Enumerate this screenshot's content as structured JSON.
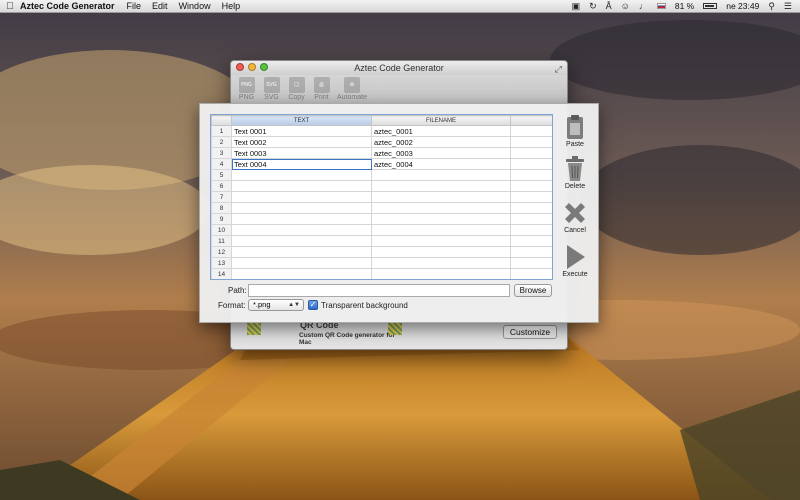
{
  "menubar": {
    "app_name": "Aztec Code Generator",
    "menus": [
      "File",
      "Edit",
      "Window",
      "Help"
    ],
    "status": {
      "battery": "81 %",
      "clock": "ne 23:49"
    }
  },
  "window": {
    "title": "Aztec Code Generator",
    "toolbar": [
      {
        "label": "PNG",
        "icon": "png-icon"
      },
      {
        "label": "SVG",
        "icon": "svg-icon"
      },
      {
        "label": "Copy",
        "icon": "copy-icon"
      },
      {
        "label": "Print",
        "icon": "print-icon"
      },
      {
        "label": "Automate",
        "icon": "automate-icon"
      }
    ],
    "banner": {
      "title": "QR Code",
      "subtitle": "Custom QR Code generator for Mac"
    },
    "customize_label": "Customize"
  },
  "sheet": {
    "columns": [
      "TEXT",
      "FILENAME"
    ],
    "rows": [
      {
        "num": "1",
        "text": "Text 0001",
        "filename": "aztec_0001"
      },
      {
        "num": "2",
        "text": "Text 0002",
        "filename": "aztec_0002"
      },
      {
        "num": "3",
        "text": "Text 0003",
        "filename": "aztec_0003"
      },
      {
        "num": "4",
        "text": "Text 0004",
        "filename": "aztec_0004"
      },
      {
        "num": "5",
        "text": "",
        "filename": ""
      },
      {
        "num": "6",
        "text": "",
        "filename": ""
      },
      {
        "num": "7",
        "text": "",
        "filename": ""
      },
      {
        "num": "8",
        "text": "",
        "filename": ""
      },
      {
        "num": "9",
        "text": "",
        "filename": ""
      },
      {
        "num": "10",
        "text": "",
        "filename": ""
      },
      {
        "num": "11",
        "text": "",
        "filename": ""
      },
      {
        "num": "12",
        "text": "",
        "filename": ""
      },
      {
        "num": "13",
        "text": "",
        "filename": ""
      },
      {
        "num": "14",
        "text": "",
        "filename": ""
      }
    ],
    "path_label": "Path:",
    "path_value": "",
    "browse_label": "Browse",
    "format_label": "Format:",
    "format_value": "*.png",
    "transparent_label": "Transparent background",
    "transparent_checked": true,
    "side_buttons": {
      "paste": "Paste",
      "delete": "Delete",
      "cancel": "Cancel",
      "execute": "Execute"
    }
  },
  "colors": {
    "selection_outline": "#3b73c8",
    "checkbox_blue": "#2f6ccb",
    "close_light": "#f05a4f",
    "minimize_light": "#f5b43a",
    "zoom_light": "#58c13e"
  }
}
